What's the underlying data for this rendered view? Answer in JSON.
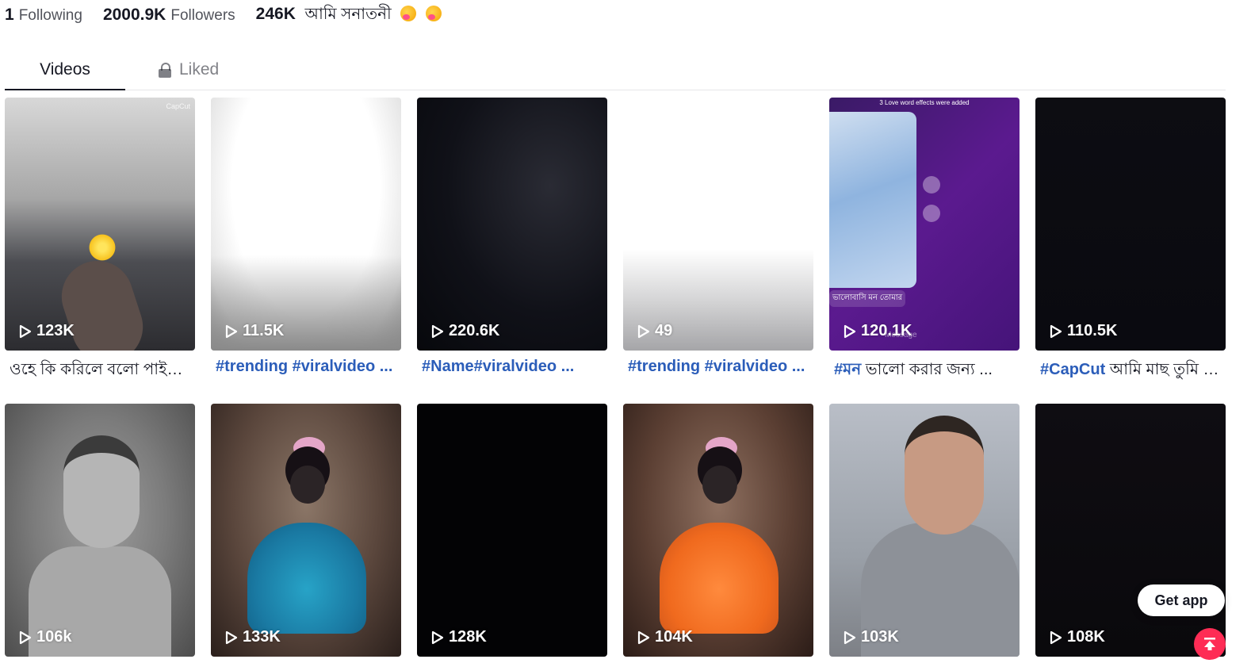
{
  "profile": {
    "following_count": "1",
    "following_label": "Following",
    "followers_count": "2000.9K",
    "followers_label": "Followers",
    "likes_count": "246K",
    "bio": "আমি সনাতনী"
  },
  "tabs": {
    "videos": "Videos",
    "liked": "Liked"
  },
  "videos": [
    {
      "views": "123K",
      "caption_tag": "",
      "caption_text": "ওহে কি করিলে বলো পাইয়ে তোমারে"
    },
    {
      "views": "11.5K",
      "caption_tag": "#trending #viralvideo ...",
      "caption_text": ""
    },
    {
      "views": "220.6K",
      "caption_tag": "#Name#viralvideo ...",
      "caption_text": ""
    },
    {
      "views": "49",
      "caption_tag": "#trending #viralvideo ...",
      "caption_text": ""
    },
    {
      "views": "120.1K",
      "caption_tag": "#মন",
      "caption_text": " ভালো করার জন্য ..."
    },
    {
      "views": "110.5K",
      "caption_tag": "#CapCut",
      "caption_text": " আমি মাছ তুমি জল"
    },
    {
      "views": "106k",
      "caption_tag": "",
      "caption_text": ""
    },
    {
      "views": "133K",
      "caption_tag": "",
      "caption_text": ""
    },
    {
      "views": "128K",
      "caption_tag": "",
      "caption_text": ""
    },
    {
      "views": "104K",
      "caption_tag": "",
      "caption_text": ""
    },
    {
      "views": "103K",
      "caption_tag": "",
      "caption_text": ""
    },
    {
      "views": "108K",
      "caption_tag": "",
      "caption_text": ""
    }
  ],
  "thumb_text": {
    "capcut_mark": "CapCut",
    "love_effect": "3 Love word effects were added",
    "message_snippet": "ভালোবাসি মন তোমার",
    "message_placeholder": "Message"
  },
  "floating": {
    "get_app": "Get app"
  },
  "colors": {
    "hashtag": "#2b5db9",
    "accent": "#fe2c55",
    "text": "#161823"
  },
  "icons": {
    "play": "play-icon",
    "lock": "lock-icon",
    "to_top": "arrow-up-icon"
  }
}
